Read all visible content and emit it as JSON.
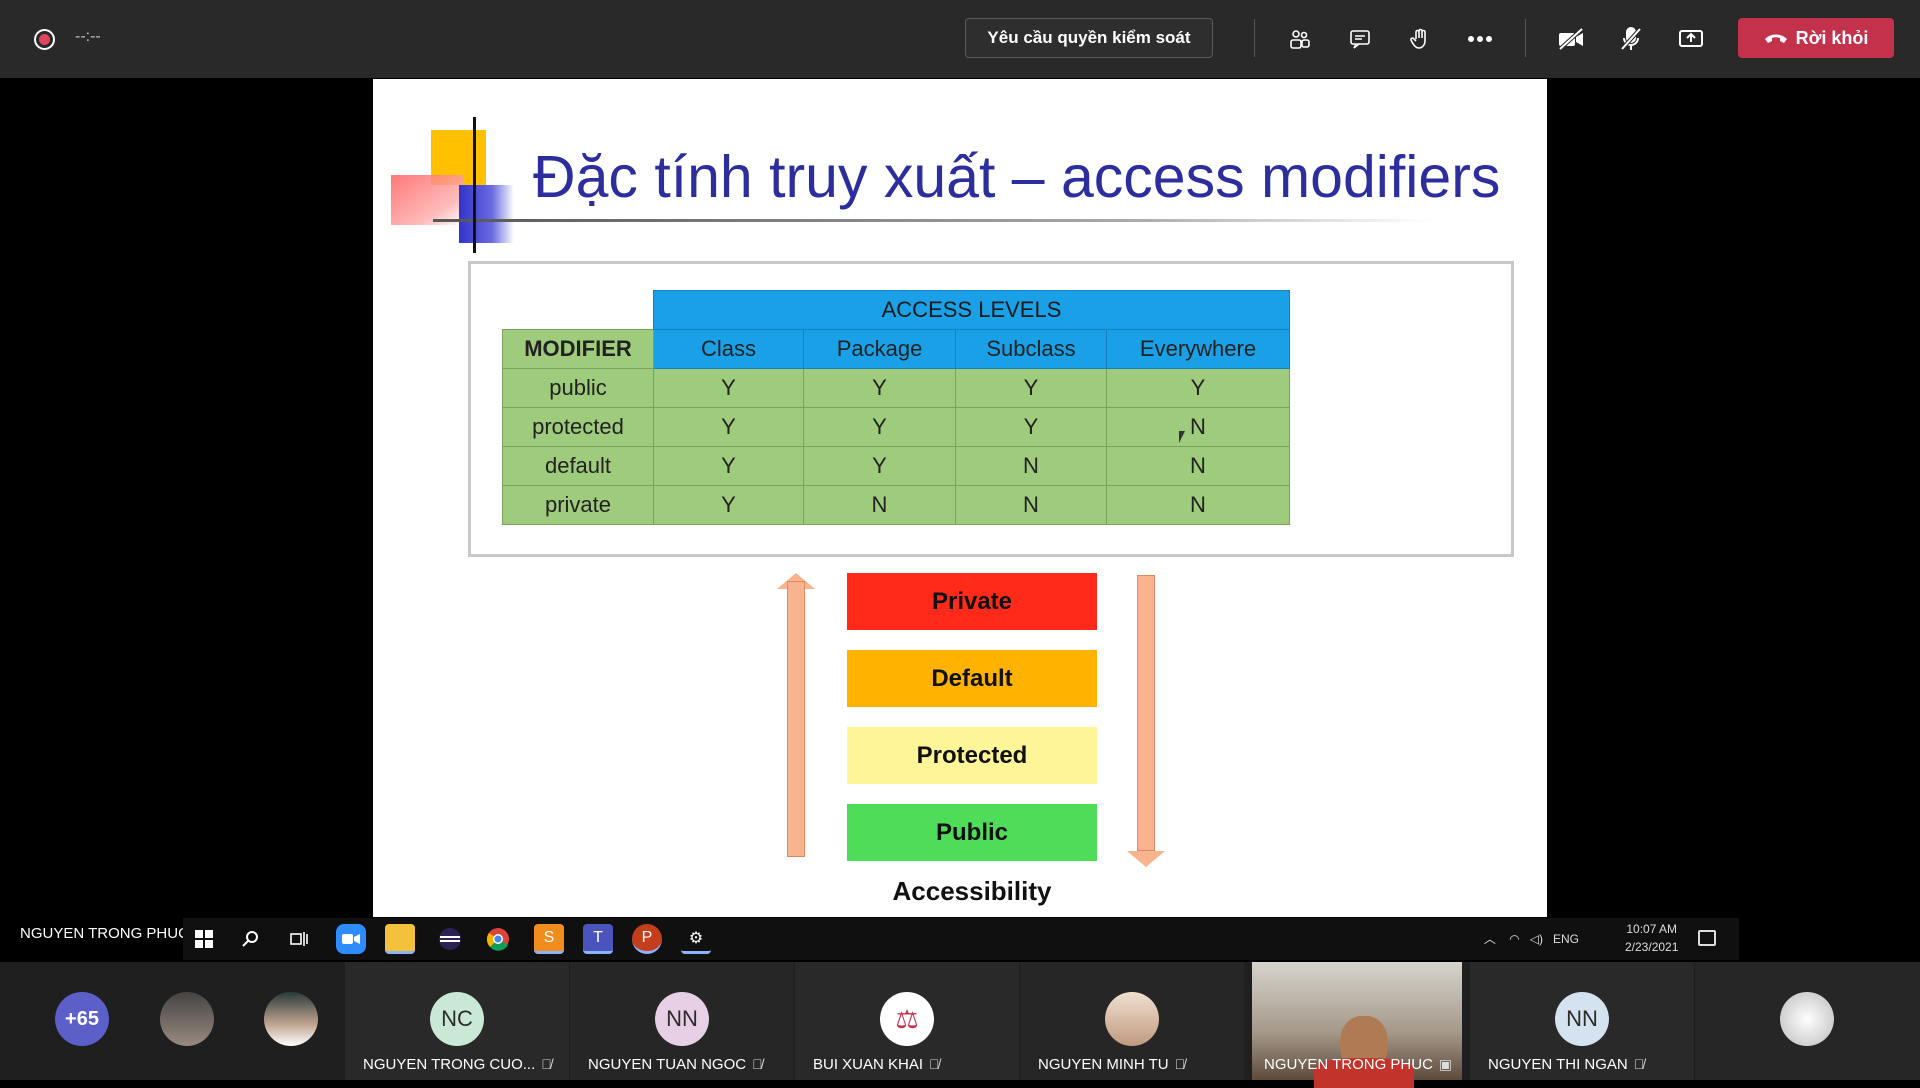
{
  "meeting": {
    "timer": "--:--",
    "request_control_label": "Yêu cầu quyền kiểm soát",
    "leave_label": "Rời khỏi"
  },
  "slide": {
    "title": "Đặc tính truy xuất – access modifiers",
    "table": {
      "group_header": "ACCESS LEVELS",
      "columns": [
        "MODIFIER",
        "Class",
        "Package",
        "Subclass",
        "Everywhere"
      ],
      "rows": [
        [
          "public",
          "Y",
          "Y",
          "Y",
          "Y"
        ],
        [
          "protected",
          "Y",
          "Y",
          "Y",
          "N"
        ],
        [
          "default",
          "Y",
          "Y",
          "N",
          "N"
        ],
        [
          "private",
          "Y",
          "N",
          "N",
          "N"
        ]
      ]
    },
    "levels": [
      {
        "label": "Private",
        "color": "#ff2a1a"
      },
      {
        "label": "Default",
        "color": "#ffb300"
      },
      {
        "label": "Protected",
        "color": "#fdf597"
      },
      {
        "label": "Public",
        "color": "#4fdc59"
      }
    ],
    "accessibility_label": "Accessibility"
  },
  "presenter_label": "NGUYEN TRONG PHUC",
  "taskbar": {
    "tray_lang": "ENG",
    "time": "10:07 AM",
    "date": "2/23/2021"
  },
  "participants": {
    "more_count": "+65",
    "tiles": [
      {
        "initials": "NC",
        "name": "NGUYEN TRONG CUO...",
        "color": "#c9e8d6"
      },
      {
        "initials": "NN",
        "name": "NGUYEN TUAN NGOC",
        "color": "#e7d0e6"
      },
      {
        "initials": "",
        "name": "BUI XUAN KHAI",
        "color": "#ffffff"
      },
      {
        "initials": "",
        "name": "NGUYEN MINH TU",
        "color": "#d9c2b0"
      },
      {
        "initials": "",
        "name": "NGUYEN TRONG PHUC",
        "color": ""
      },
      {
        "initials": "NN",
        "name": "NGUYEN THI NGAN",
        "color": "#d4e3ef"
      }
    ]
  }
}
